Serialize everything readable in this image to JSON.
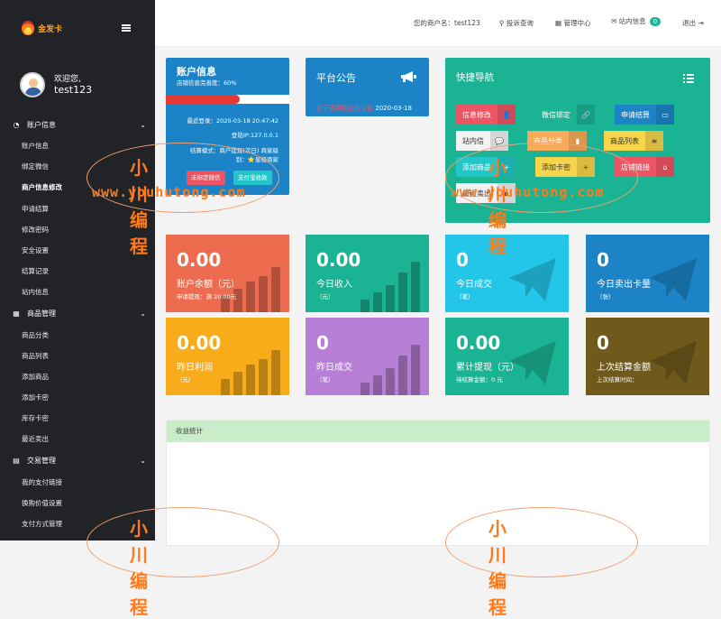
{
  "brand": {
    "name": "金发卡"
  },
  "user": {
    "welcome": "欢迎您,",
    "name": "test123"
  },
  "sidebar": {
    "groups": [
      {
        "icon": "dashboard-icon",
        "glyph": "◔",
        "label": "账户信息",
        "items": [
          "账户信息",
          "绑定微信",
          "商户信息修改",
          "申请结算",
          "修改密码",
          "安全设置",
          "结算记录",
          "站内信息"
        ]
      },
      {
        "icon": "grid-icon",
        "glyph": "▦",
        "label": "商品管理",
        "items": [
          "商品分类",
          "商品列表",
          "添加商品",
          "添加卡密",
          "库存卡密",
          "最近卖出"
        ]
      },
      {
        "icon": "document-icon",
        "glyph": "▤",
        "label": "交易管理",
        "items": [
          "我的支付链接",
          "换购价值设置",
          "支付方式管理"
        ]
      }
    ],
    "active_item": "商户信息修改"
  },
  "topbar": {
    "merchant_label": "您的商户名：test123",
    "complaint": "投诉查询",
    "admin_center": "管理中心",
    "messages": "站内信息",
    "message_count": "0",
    "logout": "退出"
  },
  "account_card": {
    "title": "账户信息",
    "completeness": "店铺信息完善度：60%",
    "progress_fraction": 0.6,
    "last_login": "最近登录：2020-03-18 20:47:42",
    "login_ip": "登陆IP:127.0.0.1",
    "settlement_mode": "结算模式：商户提现(次日) 商家级",
    "level": "别：⭐星级商家",
    "bind_wechat_btn": "未绑定微信",
    "alipay_btn": "支付宝收款"
  },
  "notice_card": {
    "title": "平台公告",
    "item_text": "关于近期信息的公告",
    "item_date": "2020-03-18"
  },
  "quick_nav": {
    "title": "快捷导航",
    "buttons": [
      {
        "label": "信息修改",
        "color": "#ed5565",
        "icon": "user-icon",
        "glyph": "👤"
      },
      {
        "label": "微信绑定",
        "color": "#1ab394",
        "icon": "link-icon",
        "glyph": "🔗"
      },
      {
        "label": "申请结算",
        "color": "#1c84c6",
        "icon": "card-icon",
        "glyph": "▭"
      },
      {
        "label": "站内信",
        "color": "#f3f3f4",
        "icon": "comments-icon",
        "glyph": "💬"
      },
      {
        "label": "商品分类",
        "color": "#f8ac59",
        "icon": "book-icon",
        "glyph": "▮"
      },
      {
        "label": "商品列表",
        "color": "#f7d54a",
        "icon": "list-icon",
        "glyph": "≡"
      },
      {
        "label": "添加商品",
        "color": "#23c6c8",
        "icon": "add-user-icon",
        "glyph": "+"
      },
      {
        "label": "添加卡密",
        "color": "#f7d54a",
        "icon": "add-icon",
        "glyph": "+"
      },
      {
        "label": "店铺链接",
        "color": "#ed5565",
        "icon": "home-icon",
        "glyph": "⌂"
      },
      {
        "label": "最近卖出",
        "color": "#f3f3f4",
        "icon": "cart-icon",
        "glyph": "▪"
      }
    ]
  },
  "stats": [
    {
      "value": "0.00",
      "label": "账户余额（元）",
      "sub": "申请提现：满 20.00元",
      "color": "#ed6b4e",
      "deco": "bars"
    },
    {
      "value": "0.00",
      "label": "今日收入",
      "sub": "（元）",
      "color": "#1ab394",
      "deco": "bars"
    },
    {
      "value": "0",
      "label": "今日成交",
      "sub": "（笔）",
      "color": "#23c6e8",
      "deco": "plane"
    },
    {
      "value": "0",
      "label": "今日卖出卡量",
      "sub": "（张）",
      "color": "#1c84c6",
      "deco": "plane"
    },
    {
      "value": "0.00",
      "label": "昨日利润",
      "sub": "（元）",
      "color": "#f8ac19",
      "deco": "bars"
    },
    {
      "value": "0",
      "label": "昨日成交",
      "sub": "（笔）",
      "color": "#b87fd6",
      "deco": "bars"
    },
    {
      "value": "0.00",
      "label": "累计提现（元）",
      "sub": "待结算金额：0 元",
      "color": "#1ab394",
      "deco": "plane"
    },
    {
      "value": "0",
      "label": "上次结算金额",
      "sub": "上次结算时间：",
      "color": "#6f5a1c",
      "deco": "plane"
    }
  ],
  "income": {
    "title": "收益统计"
  },
  "watermark": {
    "cn": "小川编程",
    "en": "www.youhutong.com"
  }
}
